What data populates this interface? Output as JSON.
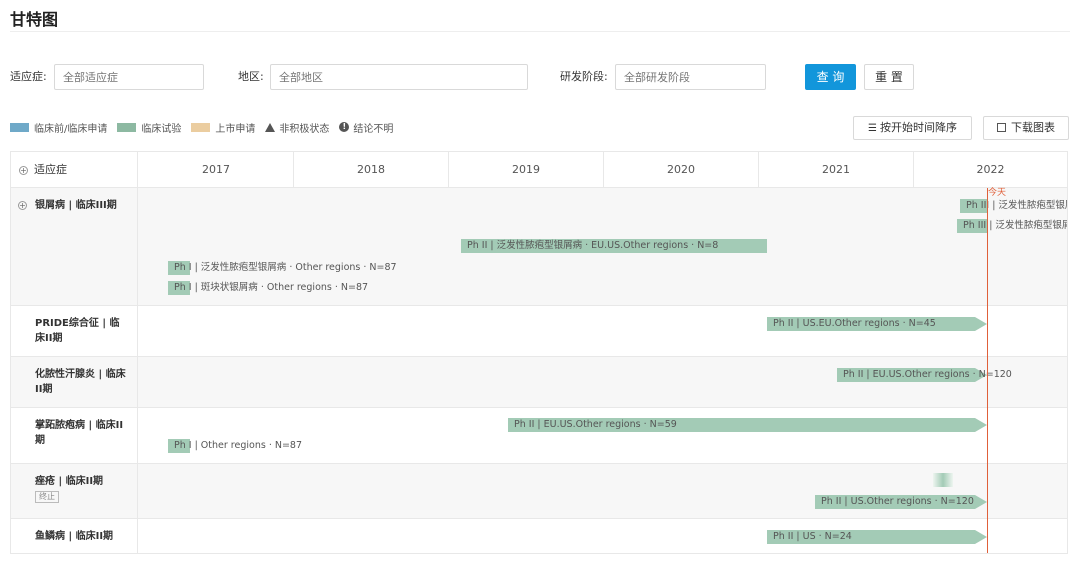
{
  "page": {
    "title": "甘特图"
  },
  "filters": {
    "indication": {
      "label": "适应症:",
      "placeholder": "全部适应症"
    },
    "region": {
      "label": "地区:",
      "placeholder": "全部地区"
    },
    "phase": {
      "label": "研发阶段:",
      "placeholder": "全部研发阶段"
    },
    "query_label": "查 询",
    "reset_label": "重 置"
  },
  "legend": {
    "items": [
      {
        "label": "临床前/临床申请",
        "color": "#6fa9c8"
      },
      {
        "label": "临床试验",
        "color": "#8db9a2"
      },
      {
        "label": "上市申请",
        "color": "#ebcda0"
      }
    ],
    "inactive_label": "非积极状态",
    "inconclusive_label": "结论不明"
  },
  "toolbar": {
    "sort_label": "按开始时间降序",
    "sort_icon": "list-sort-icon",
    "download_label": "下载图表",
    "download_icon": "image-download-icon"
  },
  "gantt": {
    "header_label": "适应症",
    "years": [
      "2017",
      "2018",
      "2019",
      "2020",
      "2021",
      "2022"
    ],
    "today_label": "今天",
    "rows": [
      {
        "label": "银屑病 | 临床III期",
        "expandable": true,
        "tag": "",
        "bars": [
          {
            "text": "Ph III | 泛发性脓疱型银屑病"
          },
          {
            "text": "Ph III | 泛发性脓疱型银屑病"
          },
          {
            "text": "Ph II | 泛发性脓疱型银屑病 · EU.US.Other regions · N=8"
          },
          {
            "text": "Ph I | 泛发性脓疱型银屑病 · Other regions · N=87"
          },
          {
            "text": "Ph I | 斑块状银屑病 · Other regions · N=87"
          }
        ]
      },
      {
        "label": "PRIDE综合征 | 临床II期",
        "expandable": false,
        "tag": "",
        "bars": [
          {
            "text": "Ph II | US.EU.Other regions · N=45"
          }
        ]
      },
      {
        "label": "化脓性汗腺炎 | 临床II期",
        "expandable": false,
        "tag": "",
        "bars": [
          {
            "text": "Ph II | EU.US.Other regions · N=120"
          }
        ]
      },
      {
        "label": "掌跖脓疱病 | 临床II期",
        "expandable": false,
        "tag": "",
        "bars": [
          {
            "text": "Ph II | EU.US.Other regions · N=59"
          },
          {
            "text": "Ph I | Other regions · N=87"
          }
        ]
      },
      {
        "label": "痤疮 | 临床II期",
        "expandable": false,
        "tag": "终止",
        "bars": [
          {
            "text": "Ph II | US.Other regions · N=120"
          }
        ]
      },
      {
        "label": "鱼鳞病 | 临床II期",
        "expandable": false,
        "tag": "",
        "bars": [
          {
            "text": "Ph II | US · N=24"
          }
        ]
      }
    ]
  }
}
